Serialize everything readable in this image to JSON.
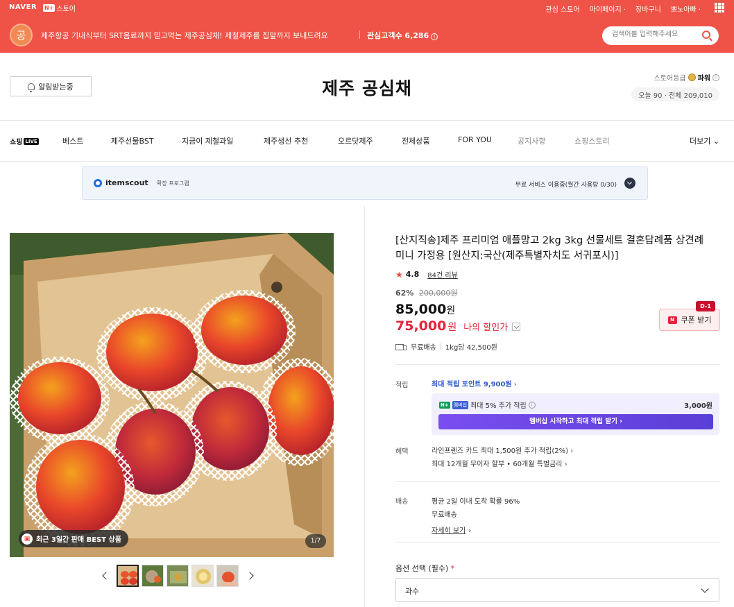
{
  "top_bar": {
    "naver": "NAVER",
    "nstore_badge": "N+",
    "nstore_label": "스토어",
    "links": [
      "관심 스토어",
      "마이페이지 ·",
      "장바구니",
      "뽀노아빠 ·"
    ]
  },
  "store_banner": {
    "avatar": "공",
    "text": "제주항공 기내식부터 SRT음료까지 믿고먹는 제주공심채! 제철제주를 집앞까지 보내드려요",
    "interest_label": "관심고객수 6,286",
    "search_placeholder": "검색어를 입력해주세요"
  },
  "store_header": {
    "alarm_button": "알림받는중",
    "store_name": "제주 공심채",
    "grade_label": "스토어등급",
    "grade_value": "파워",
    "visits": "오늘 90 · 전체 209,010"
  },
  "nav": {
    "live_label": "쇼핑",
    "live_badge": "LIVE",
    "items": [
      "베스트",
      "제주선물BST",
      "지금이 제철과일",
      "제주생선 추천",
      "오르닷제주",
      "전체상품",
      "FOR YOU",
      "공지사항",
      "쇼핑스토리"
    ],
    "more": "더보기 ⌄"
  },
  "itemscout": {
    "name": "itemscout",
    "tag": "확장 프로그램",
    "status": "무료 서비스 이용중(월간 사용량 0/30)"
  },
  "gallery": {
    "best_badge": "최근 3일간 판매 BEST 상품",
    "best_icon": "gift-icon",
    "page_count": "1/7"
  },
  "product": {
    "title": "[산지직송]제주 프리미엄 애플망고 2kg 3kg 선물세트 결혼답례품 상견례 미니 가정용 [원산지:국산(제주특별자치도 서귀포시)]",
    "rating": "4.8",
    "reviews": "84건 리뷰",
    "discount_pct": "62%",
    "original_price": "200,000원",
    "price": "85,000",
    "price_won": "원",
    "my_price": "75,000",
    "my_price_won": "원",
    "my_discount_label": "나의 할인가",
    "coupon_label": "쿠폰 받기",
    "coupon_dday": "D-1",
    "shipping": "무료배송",
    "unit_price": "1kg당 42,500원"
  },
  "points_section": {
    "label": "적립",
    "max_points": "최대 적립 포인트 9,900원",
    "member_badge": "N+",
    "member_badge2": "멤버십",
    "member_text": "최대 5% 추가 적립",
    "member_amount": "3,000원",
    "member_button": "멤버십 시작하고 최대 적립 받기 ›"
  },
  "benefit_section": {
    "label": "혜택",
    "line1": "라인프렌즈 카드 최대 1,500원 추가 적립(2%)",
    "line2": "최대 12개월 무이자 할부 • 60개월 특별금리"
  },
  "delivery_section": {
    "label": "배송",
    "line1": "평균 2일 이내 도착 확률 96%",
    "line2": "무료배송",
    "more": "자세히 보기"
  },
  "option": {
    "label": "옵션 선택 (필수)",
    "required_mark": "*",
    "selected": "과수"
  }
}
